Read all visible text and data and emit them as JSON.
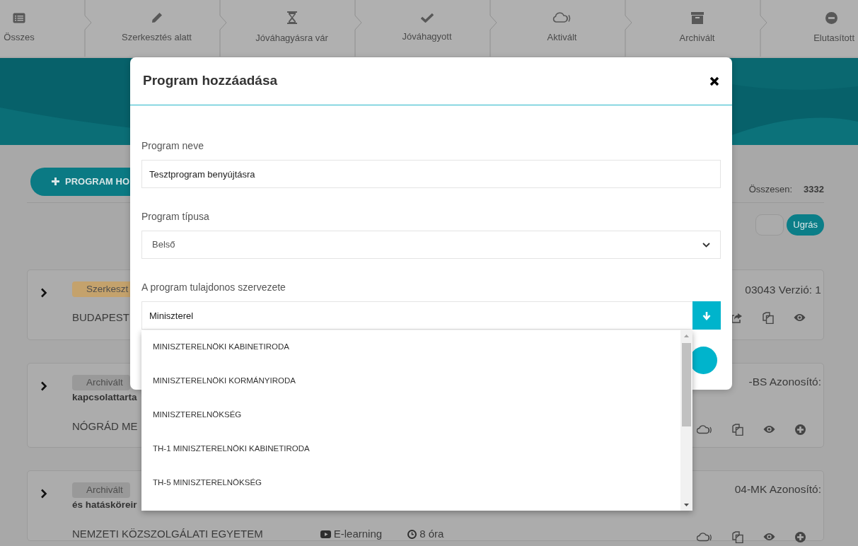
{
  "steps": [
    {
      "label": "Összes"
    },
    {
      "label": "Szerkesztés alatt"
    },
    {
      "label": "Jóváhagyásra vár"
    },
    {
      "label": "Jóváhagyott"
    },
    {
      "label": "Aktivált"
    },
    {
      "label": "Archivált"
    },
    {
      "label": "Elutasított"
    }
  ],
  "toolbar": {
    "add_button": "PROGRAM HO",
    "total_label": "Összesen:",
    "total_value": "3332",
    "jump_button": "Ugrás"
  },
  "programs": [
    {
      "status": "Szerkeszt",
      "color": "#c4a26c",
      "org": "BUDAPEST",
      "right_text": "03043 Verzió: 1",
      "actions": [
        {
          "kind": "share"
        },
        {
          "kind": "copy"
        },
        {
          "kind": "view"
        }
      ]
    },
    {
      "status": "Archivált",
      "color": "#999999",
      "title": "kapcsolattarta",
      "org": "NÓGRÁD ME",
      "right_text": "-BS Azonosító:",
      "actions": [
        {
          "kind": "cloud"
        },
        {
          "kind": "copy"
        },
        {
          "kind": "view"
        },
        {
          "kind": "add"
        }
      ]
    },
    {
      "status": "Archivált",
      "color": "#999999",
      "title": "és hatásköreir",
      "org": "NEMZETI KÖZSZOLGÁLATI EGYETEM",
      "format": "E-learning",
      "duration": "8 óra",
      "right_text": "04-MK Azonosító:",
      "actions": [
        {
          "kind": "cloud"
        },
        {
          "kind": "copy"
        },
        {
          "kind": "view"
        },
        {
          "kind": "add"
        }
      ]
    }
  ],
  "modal": {
    "title": "Program hozzáadása",
    "fields": [
      {
        "kind": "text",
        "label": "Program neve",
        "value": "Tesztprogram benyújtásra"
      },
      {
        "kind": "select",
        "label": "Program típusa",
        "value": "Belső"
      },
      {
        "kind": "autocomplete",
        "label": "A program tulajdonos szervezete",
        "value": "Miniszterel",
        "expanded": true,
        "options": [
          "MINISZTERELNÖKI KABINETIRODA",
          "MINISZTERELNÖKI KORMÁNYIRODA",
          "MINISZTERELNÖKSÉG",
          "TH-1 MINISZTERELNÖKI KABINETIRODA",
          "TH-5 MINISZTERELNÖKSÉG"
        ]
      }
    ]
  }
}
